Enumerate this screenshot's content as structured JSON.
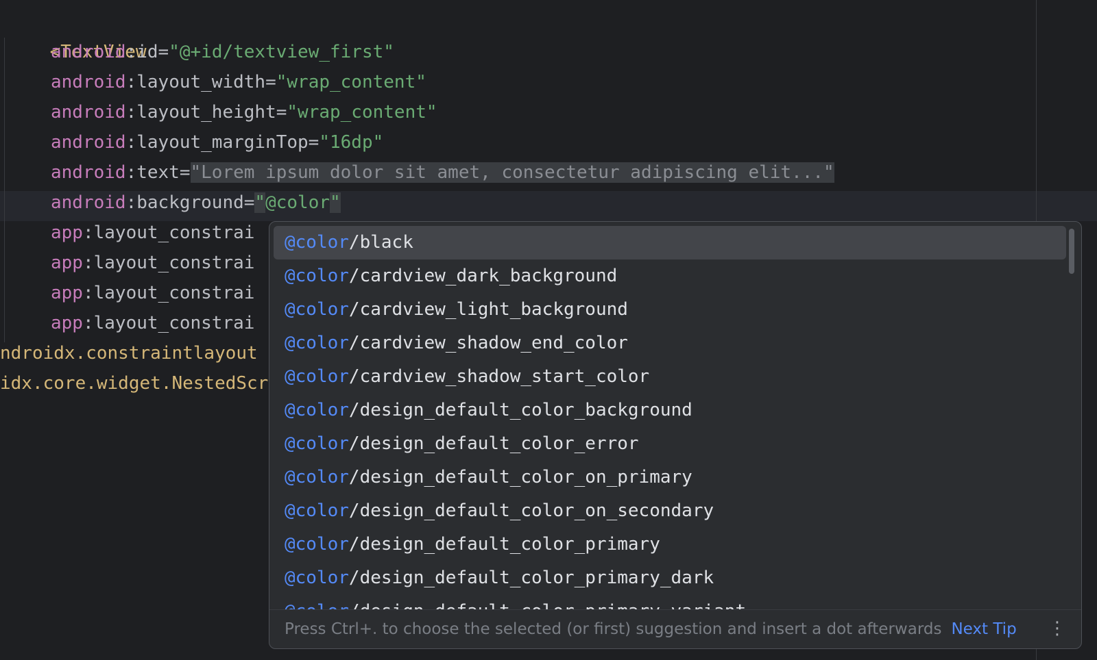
{
  "code_lines": [
    {
      "tag_open": "<TextView"
    },
    {
      "ns": "android",
      "attr": ":id=",
      "value": "\"@+id/textview_first\""
    },
    {
      "ns": "android",
      "attr": ":layout_width=",
      "value": "\"wrap_content\""
    },
    {
      "ns": "android",
      "attr": ":layout_height=",
      "value": "\"wrap_content\""
    },
    {
      "ns": "android",
      "attr": ":layout_marginTop=",
      "value": "\"16dp\""
    },
    {
      "ns": "android",
      "attr": ":text=",
      "value": "\"Lorem ipsum dolor sit amet, consectetur adipiscing elit...\""
    },
    {
      "ns": "android",
      "attr": ":background=",
      "value_q": "\"",
      "value": "@color",
      "value_q2": "\""
    },
    {
      "ns": "app",
      "attr": ":layout_constrai"
    },
    {
      "ns": "app",
      "attr": ":layout_constrai"
    },
    {
      "ns": "app",
      "attr": ":layout_constrai"
    },
    {
      "ns": "app",
      "attr": ":layout_constrai"
    },
    {
      "tag_text": "ndroidx.constraintlayout"
    },
    {
      "tag_text": "idx.core.widget.NestedScr"
    }
  ],
  "completion": {
    "prefix": "@color",
    "items": [
      "/black",
      "/cardview_dark_background",
      "/cardview_light_background",
      "/cardview_shadow_end_color",
      "/cardview_shadow_start_color",
      "/design_default_color_background",
      "/design_default_color_error",
      "/design_default_color_on_primary",
      "/design_default_color_on_secondary",
      "/design_default_color_primary",
      "/design_default_color_primary_dark",
      "/design_default_color_primary_variant"
    ],
    "selected_index": 0,
    "tip": "Press Ctrl+. to choose the selected (or first) suggestion and insert a dot afterwards",
    "next_tip_label": "Next Tip",
    "more_icon": "vertical-ellipsis-icon"
  },
  "colors": {
    "background": "#1e1f22",
    "tag": "#d5b778",
    "namespace": "#c77dbb",
    "string": "#6aab73",
    "accent": "#548af7"
  }
}
